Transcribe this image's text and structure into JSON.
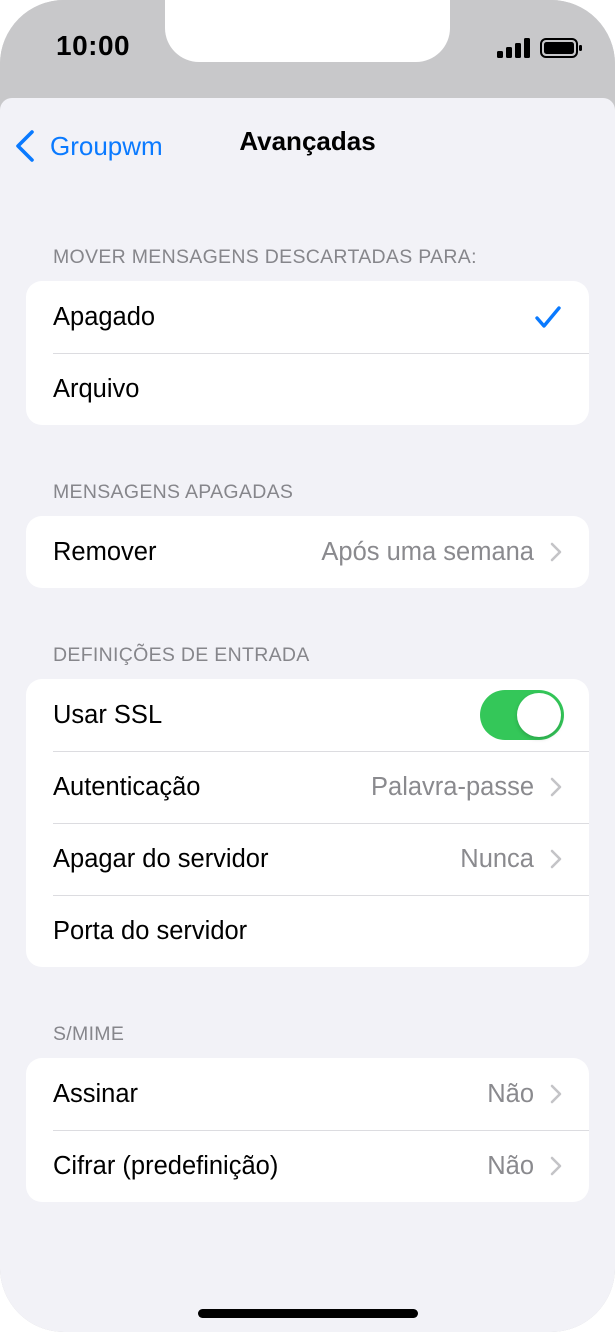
{
  "status_bar": {
    "time": "10:00"
  },
  "nav": {
    "back_label": "Groupwm",
    "title": "Avançadas"
  },
  "sections": {
    "discard": {
      "header": "MOVER MENSAGENS DESCARTADAS PARA:",
      "rows": [
        {
          "label": "Apagado",
          "selected": true
        },
        {
          "label": "Arquivo",
          "selected": false
        }
      ]
    },
    "deleted": {
      "header": "MENSAGENS APAGADAS",
      "rows": [
        {
          "label": "Remover",
          "value": "Após uma semana"
        }
      ]
    },
    "incoming": {
      "header": "DEFINIÇÕES DE ENTRADA",
      "rows": [
        {
          "label": "Usar SSL",
          "toggle_on": true
        },
        {
          "label": "Autenticação",
          "value": "Palavra-passe"
        },
        {
          "label": "Apagar do servidor",
          "value": "Nunca"
        },
        {
          "label": "Porta do servidor"
        }
      ]
    },
    "smime": {
      "header": "S/MIME",
      "rows": [
        {
          "label": "Assinar",
          "value": "Não"
        },
        {
          "label": "Cifrar (predefinição)",
          "value": "Não"
        }
      ]
    }
  },
  "colors": {
    "accent": "#0a7aff",
    "toggle_on": "#34c759",
    "background": "#f2f2f7"
  }
}
